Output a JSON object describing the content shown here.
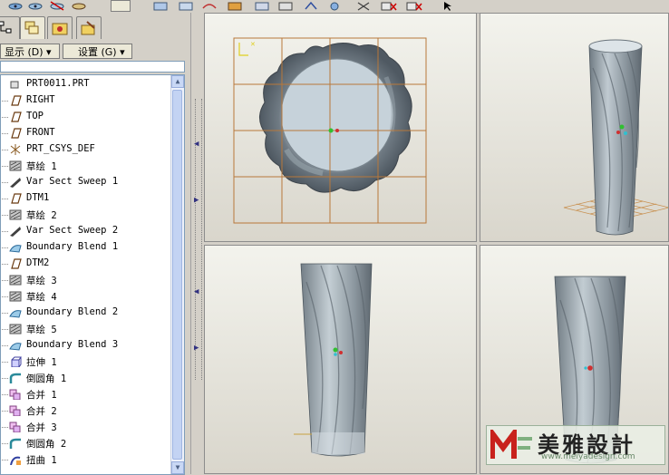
{
  "colors": {
    "tree_bg": "#ffffff",
    "panel_bg": "#d4d0c8",
    "viewport_bg": "#e8e6de",
    "model": "#8f99a0",
    "grid": "#b8783a",
    "watermark_red": "#c8221c"
  },
  "left_panel": {
    "tabs": [
      "model-tree-icon",
      "layers-icon",
      "folder-icon",
      "favorites-icon"
    ],
    "display_button": "显示 (D) ▾",
    "settings_button": "设置 (G) ▾"
  },
  "model_tree": {
    "items": [
      {
        "label": "PRT0011.PRT",
        "icon": "part-icon"
      },
      {
        "label": "RIGHT",
        "icon": "datum-plane-icon"
      },
      {
        "label": "TOP",
        "icon": "datum-plane-icon"
      },
      {
        "label": "FRONT",
        "icon": "datum-plane-icon"
      },
      {
        "label": "PRT_CSYS_DEF",
        "icon": "csys-icon"
      },
      {
        "label": "草绘 1",
        "icon": "sketch-icon"
      },
      {
        "label": "Var Sect Sweep 1",
        "icon": "sweep-icon"
      },
      {
        "label": "DTM1",
        "icon": "datum-plane-icon"
      },
      {
        "label": "草绘 2",
        "icon": "sketch-icon"
      },
      {
        "label": "Var Sect Sweep 2",
        "icon": "sweep-icon"
      },
      {
        "label": "Boundary Blend 1",
        "icon": "blend-icon"
      },
      {
        "label": "DTM2",
        "icon": "datum-plane-icon"
      },
      {
        "label": "草绘 3",
        "icon": "sketch-icon"
      },
      {
        "label": "草绘 4",
        "icon": "sketch-icon"
      },
      {
        "label": "Boundary Blend 2",
        "icon": "blend-icon"
      },
      {
        "label": "草绘 5",
        "icon": "sketch-icon"
      },
      {
        "label": "Boundary Blend 3",
        "icon": "blend-icon"
      },
      {
        "label": "拉伸 1",
        "icon": "extrude-icon"
      },
      {
        "label": "倒圆角 1",
        "icon": "round-icon"
      },
      {
        "label": "合并 1",
        "icon": "merge-icon"
      },
      {
        "label": "合并 2",
        "icon": "merge-icon"
      },
      {
        "label": "合并 3",
        "icon": "merge-icon"
      },
      {
        "label": "倒圆角 2",
        "icon": "round-icon"
      },
      {
        "label": "扭曲 1",
        "icon": "warp-icon"
      }
    ]
  },
  "watermark": {
    "brand": "美雅設計",
    "url": "www.meiyadesign.com"
  }
}
